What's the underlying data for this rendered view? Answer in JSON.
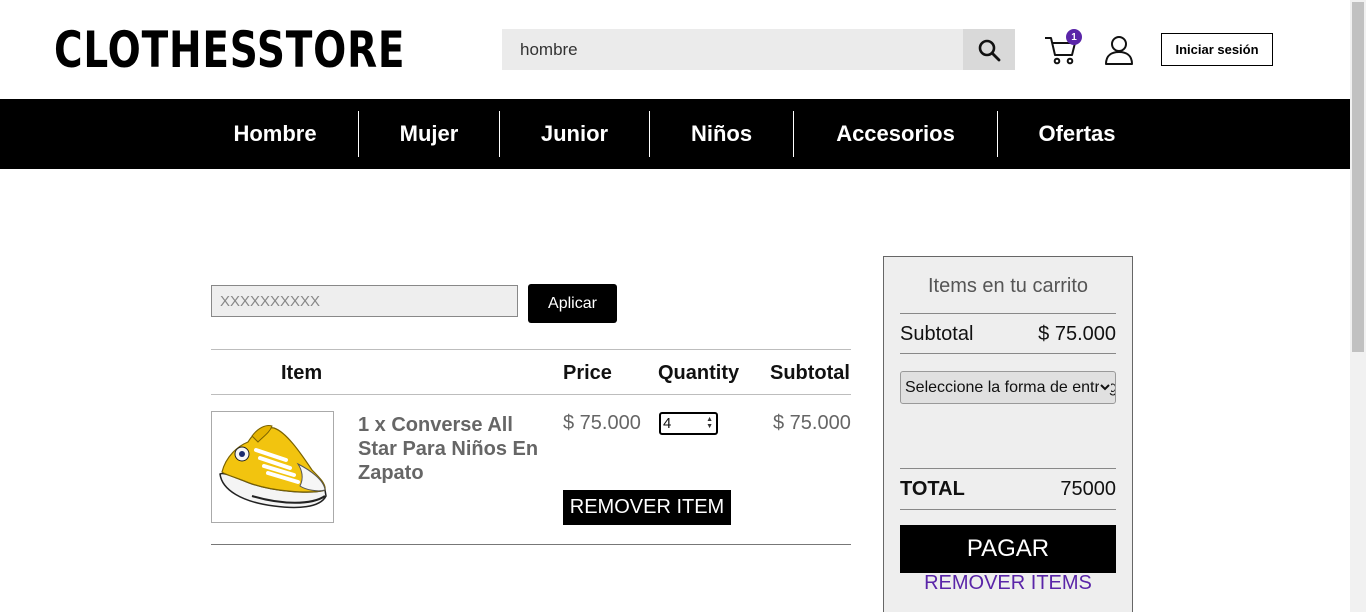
{
  "header": {
    "logo": "CLOTHESSTORE",
    "search_value": "hombre",
    "cart_count": "1",
    "login_label": "Iniciar sesión"
  },
  "nav": {
    "items": [
      {
        "label": "Hombre"
      },
      {
        "label": "Mujer"
      },
      {
        "label": "Junior"
      },
      {
        "label": "Niños"
      },
      {
        "label": "Accesorios"
      },
      {
        "label": "Ofertas"
      }
    ]
  },
  "coupon": {
    "placeholder": "XXXXXXXXXX",
    "apply_label": "Aplicar"
  },
  "table": {
    "headers": {
      "item": "Item",
      "price": "Price",
      "quantity": "Quantity",
      "subtotal": "Subtotal"
    },
    "rows": [
      {
        "name": "1 x Converse All Star Para Niños En Zapato",
        "price": "$ 75.000",
        "quantity": "4",
        "subtotal": "$ 75.000",
        "remove_label": "REMOVER ITEM"
      }
    ]
  },
  "summary": {
    "title": "Items en tu carrito",
    "subtotal_label": "Subtotal",
    "subtotal_value": "$ 75.000",
    "delivery_select": "Seleccione la forma de entrega",
    "total_label": "TOTAL",
    "total_value": "75000",
    "pay_label": "PAGAR",
    "remove_all_label": "REMOVER ITEMS"
  },
  "colors": {
    "accent": "#5a25a8",
    "nav_bg": "#000000",
    "panel_bg": "#eeeeee"
  }
}
